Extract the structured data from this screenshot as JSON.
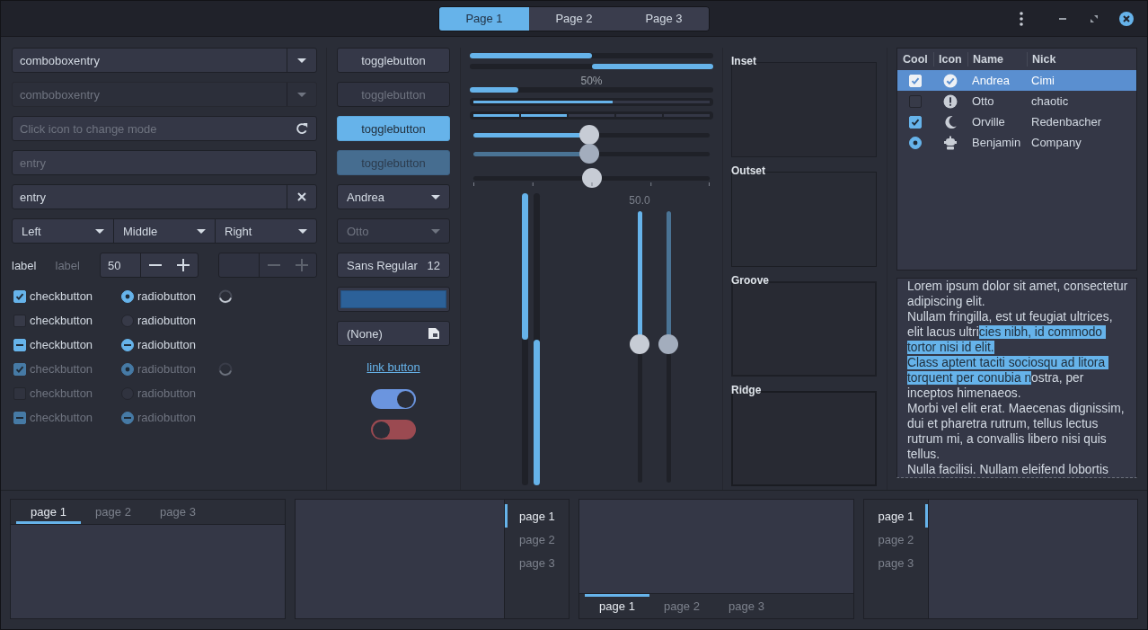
{
  "header": {
    "tabs": [
      {
        "label": "Page 1",
        "selected": true
      },
      {
        "label": "Page 2",
        "selected": false
      },
      {
        "label": "Page 3",
        "selected": false
      }
    ]
  },
  "entries": [
    {
      "kind": "combo",
      "text": "comboboxentry",
      "disabled": false
    },
    {
      "kind": "combo",
      "text": "comboboxentry",
      "disabled": true
    },
    {
      "kind": "icon",
      "placeholder": "Click icon to change mode",
      "disabled": false
    },
    {
      "kind": "plain",
      "placeholder": "entry",
      "disabled": false
    },
    {
      "kind": "clear",
      "text": "entry",
      "disabled": false
    }
  ],
  "linked_combos": [
    {
      "label": "Left"
    },
    {
      "label": "Middle"
    },
    {
      "label": "Right"
    }
  ],
  "labels": [
    {
      "text": "label",
      "disabled": false
    },
    {
      "text": "label",
      "disabled": true
    }
  ],
  "spin_buttons": [
    {
      "value": "50",
      "disabled": false
    },
    {
      "disabled": true
    }
  ],
  "checks": [
    {
      "label": "checkbutton",
      "checked": true,
      "inconsistent": false,
      "disabled": false
    },
    {
      "label": "checkbutton",
      "checked": false,
      "inconsistent": false,
      "disabled": false
    },
    {
      "label": "checkbutton",
      "inconsistent": true,
      "disabled": false
    },
    {
      "label": "checkbutton",
      "checked": true,
      "inconsistent": false,
      "disabled": true
    },
    {
      "label": "checkbutton",
      "checked": false,
      "inconsistent": false,
      "disabled": true
    },
    {
      "label": "checkbutton",
      "inconsistent": true,
      "disabled": true
    }
  ],
  "radios": [
    {
      "label": "radiobutton",
      "selected": true,
      "inconsistent": false,
      "disabled": false
    },
    {
      "label": "radiobutton",
      "selected": false,
      "inconsistent": false,
      "disabled": false
    },
    {
      "label": "radiobutton",
      "inconsistent": true,
      "disabled": false
    },
    {
      "label": "radiobutton",
      "selected": true,
      "inconsistent": false,
      "disabled": true
    },
    {
      "label": "radiobutton",
      "selected": false,
      "inconsistent": false,
      "disabled": true
    },
    {
      "label": "radiobutton",
      "inconsistent": true,
      "disabled": true
    }
  ],
  "spinners": [
    {
      "disabled": false
    },
    {
      "disabled": true
    }
  ],
  "toggle_buttons": [
    {
      "label": "togglebutton",
      "active": false,
      "disabled": false
    },
    {
      "label": "togglebutton",
      "active": false,
      "disabled": true
    },
    {
      "label": "togglebutton",
      "active": true,
      "disabled": false
    },
    {
      "label": "togglebutton",
      "active": true,
      "disabled": true
    }
  ],
  "combos": [
    {
      "text": "Andrea",
      "disabled": false
    },
    {
      "text": "Otto",
      "disabled": true
    }
  ],
  "font_button": {
    "family": "Sans Regular",
    "size": "12"
  },
  "color_button": {
    "color": "#2c6199"
  },
  "file_button": {
    "label": "(None)"
  },
  "link_button": {
    "label": "link button"
  },
  "switches": [
    {
      "on": true
    },
    {
      "on": false
    }
  ],
  "progress_bars": [
    {
      "level": 0.5,
      "inverted": false
    },
    {
      "level": 0.5,
      "inverted": true
    },
    {
      "level": 0.2,
      "inverted": false,
      "text": "50%"
    }
  ],
  "level_bars": [
    {
      "kind": "continuous",
      "level": 0.59
    },
    {
      "kind": "discrete",
      "level": 0.4
    }
  ],
  "hscales": [
    {
      "level": 0.49,
      "disabled": false,
      "marks": false,
      "has_origin": true
    },
    {
      "level": 0.49,
      "disabled": true,
      "marks": false,
      "has_origin": true
    },
    {
      "level": 0.5,
      "disabled": false,
      "marks": true,
      "has_origin": false
    }
  ],
  "vprogress": [
    {
      "level": 0.5,
      "inverted": false
    },
    {
      "level": 0.5,
      "inverted": true
    }
  ],
  "vscales": [
    {
      "level": 0.49,
      "disabled": false,
      "value": "50.0"
    },
    {
      "level": 0.49,
      "disabled": true
    }
  ],
  "frames": [
    {
      "label": "Inset",
      "kind": "inset"
    },
    {
      "label": "Outset",
      "kind": "outset"
    },
    {
      "label": "Groove",
      "kind": "groove"
    },
    {
      "label": "Ridge",
      "kind": "ridge"
    }
  ],
  "tree": {
    "columns": [
      {
        "title": "Cool"
      },
      {
        "title": "Icon"
      },
      {
        "title": "Name"
      },
      {
        "title": "Nick"
      }
    ],
    "rows": [
      {
        "kind": "check",
        "checked": true,
        "name": "Andrea",
        "nick": "Cimi",
        "selected": true
      },
      {
        "kind": "check",
        "checked": false,
        "name": "Otto",
        "nick": "chaotic",
        "selected": false
      },
      {
        "kind": "check",
        "checked": true,
        "name": "Orville",
        "nick": "Redenbacher",
        "selected": false
      },
      {
        "kind": "radio",
        "checked": true,
        "name": "Benjamin",
        "nick": "Company",
        "selected": false
      }
    ]
  },
  "text_view": {
    "segments": [
      {
        "text": "Lorem ipsum dolor sit amet, consectetur adipiscing elit.\nNullam fringilla, est ut feugiat ultrices, elit lacus ultri",
        "selected": false
      },
      {
        "text": "cies nibh, id commodo tortor nisi id elit.\nClass aptent taciti sociosqu ad litora torquent per conubia n",
        "selected": true
      },
      {
        "text": "ostra, per inceptos himenaeos.\nMorbi vel elit erat. Maecenas dignissim, dui et pharetra rutrum, tellus lectus rutrum mi, a convallis libero nisi quis tellus.\nNulla facilisi. Nullam eleifend lobortis",
        "selected": false
      }
    ]
  },
  "notebooks": [
    {
      "kind": "top",
      "tabs": [
        {
          "label": "page 1",
          "selected": true
        },
        {
          "label": "page 2",
          "selected": false
        },
        {
          "label": "page 3",
          "selected": false
        }
      ]
    },
    {
      "kind": "right",
      "tabs": [
        {
          "label": "page 1",
          "selected": true
        },
        {
          "label": "page 2",
          "selected": false
        },
        {
          "label": "page 3",
          "selected": false
        }
      ]
    },
    {
      "kind": "bottom",
      "tabs": [
        {
          "label": "page 1",
          "selected": true
        },
        {
          "label": "page 2",
          "selected": false
        },
        {
          "label": "page 3",
          "selected": false
        }
      ]
    },
    {
      "kind": "left",
      "tabs": [
        {
          "label": "page 1",
          "selected": true
        },
        {
          "label": "page 2",
          "selected": false
        },
        {
          "label": "page 3",
          "selected": false
        }
      ]
    }
  ]
}
